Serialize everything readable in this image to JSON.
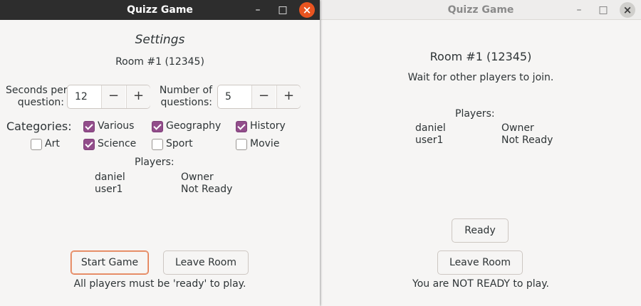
{
  "app_title": "Quizz Game",
  "window_controls": {
    "minimize": "–",
    "maximize": "□",
    "close": "×"
  },
  "left": {
    "settings_heading": "Settings",
    "room": "Room #1 (12345)",
    "seconds_label_line1": "Seconds per",
    "seconds_label_line2": "question:",
    "seconds_value": "12",
    "questions_label_line1": "Number of",
    "questions_label_line2": "questions:",
    "questions_value": "5",
    "stepper_minus": "−",
    "stepper_plus": "+",
    "categories_label": "Categories:",
    "categories": [
      {
        "label": "Various",
        "checked": true
      },
      {
        "label": "Geography",
        "checked": true
      },
      {
        "label": "History",
        "checked": true
      },
      {
        "label": "Art",
        "checked": false
      },
      {
        "label": "Science",
        "checked": true
      },
      {
        "label": "Sport",
        "checked": false
      },
      {
        "label": "Movie",
        "checked": false
      }
    ],
    "players_heading": "Players:",
    "players": [
      {
        "name": "daniel",
        "status": "Owner"
      },
      {
        "name": "user1",
        "status": "Not Ready"
      }
    ],
    "start_button": "Start Game",
    "leave_button": "Leave Room",
    "footer_message": "All players must be 'ready' to play."
  },
  "right": {
    "room": "Room #1 (12345)",
    "wait_message": "Wait for other players to join.",
    "players_heading": "Players:",
    "players": [
      {
        "name": "daniel",
        "status": "Owner"
      },
      {
        "name": "user1",
        "status": "Not Ready"
      }
    ],
    "ready_button": "Ready",
    "leave_button": "Leave Room",
    "footer_message": "You are NOT READY to play."
  },
  "colors": {
    "accent_checkbox": "#924d8b",
    "close_button_active": "#e95420",
    "titlebar_active": "#2d2d2d",
    "suggested_button_border": "#e4794f"
  }
}
